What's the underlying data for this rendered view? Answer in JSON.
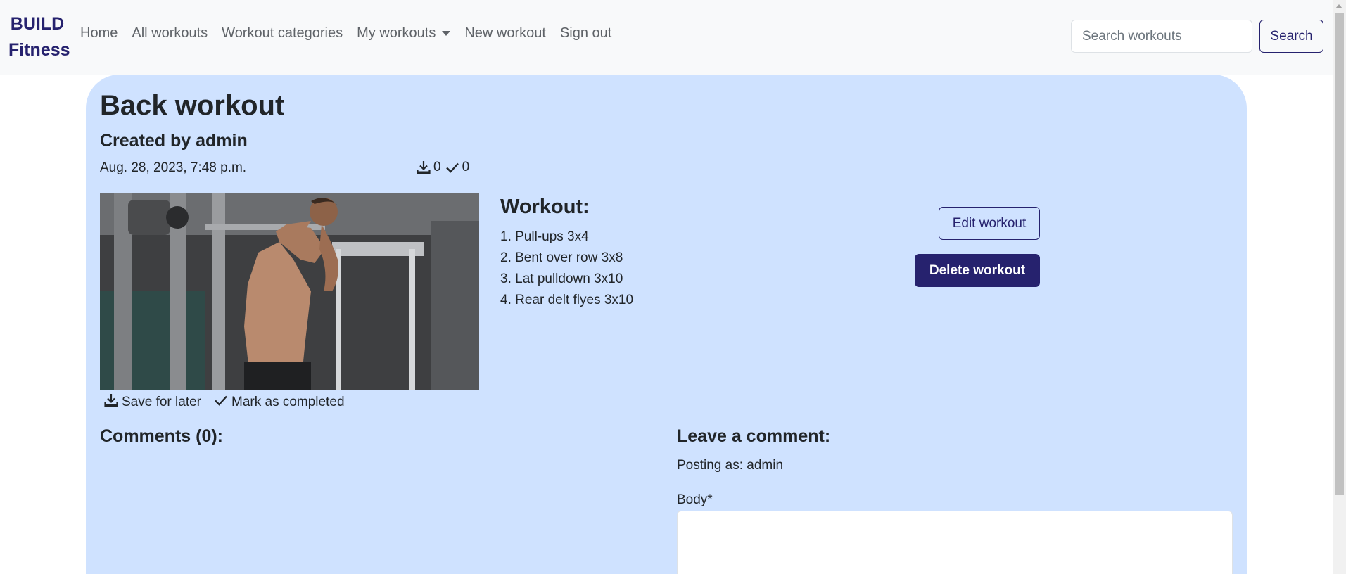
{
  "navbar": {
    "brand_line1": "BUILD",
    "brand_line2": "Fitness",
    "links": [
      "Home",
      "All workouts",
      "Workout categories",
      "My workouts",
      "New workout",
      "Sign out"
    ],
    "search_placeholder": "Search workouts",
    "search_button": "Search"
  },
  "workout": {
    "title": "Back workout",
    "author": "Created by admin",
    "date": "Aug. 28, 2023, 7:48 p.m.",
    "saves_count": "0",
    "completed_count": "0",
    "save_label": "Save for later",
    "complete_label": "Mark as completed",
    "heading": "Workout:",
    "exercises": [
      "1. Pull-ups 3x4",
      "2. Bent over row 3x8",
      "3. Lat pulldown 3x10",
      "4. Rear delt flyes 3x10"
    ],
    "edit_button": "Edit workout",
    "delete_button": "Delete workout"
  },
  "comments": {
    "heading": "Comments (0):",
    "leave_heading": "Leave a comment:",
    "posting_as": "Posting as: admin",
    "body_label": "Body*"
  },
  "colors": {
    "brand": "#26226e",
    "card_background": "#cfe2ff",
    "navbar_background": "#f8f9fa"
  },
  "icons": {
    "save": "download-tray-icon",
    "complete": "checkmark-icon"
  }
}
